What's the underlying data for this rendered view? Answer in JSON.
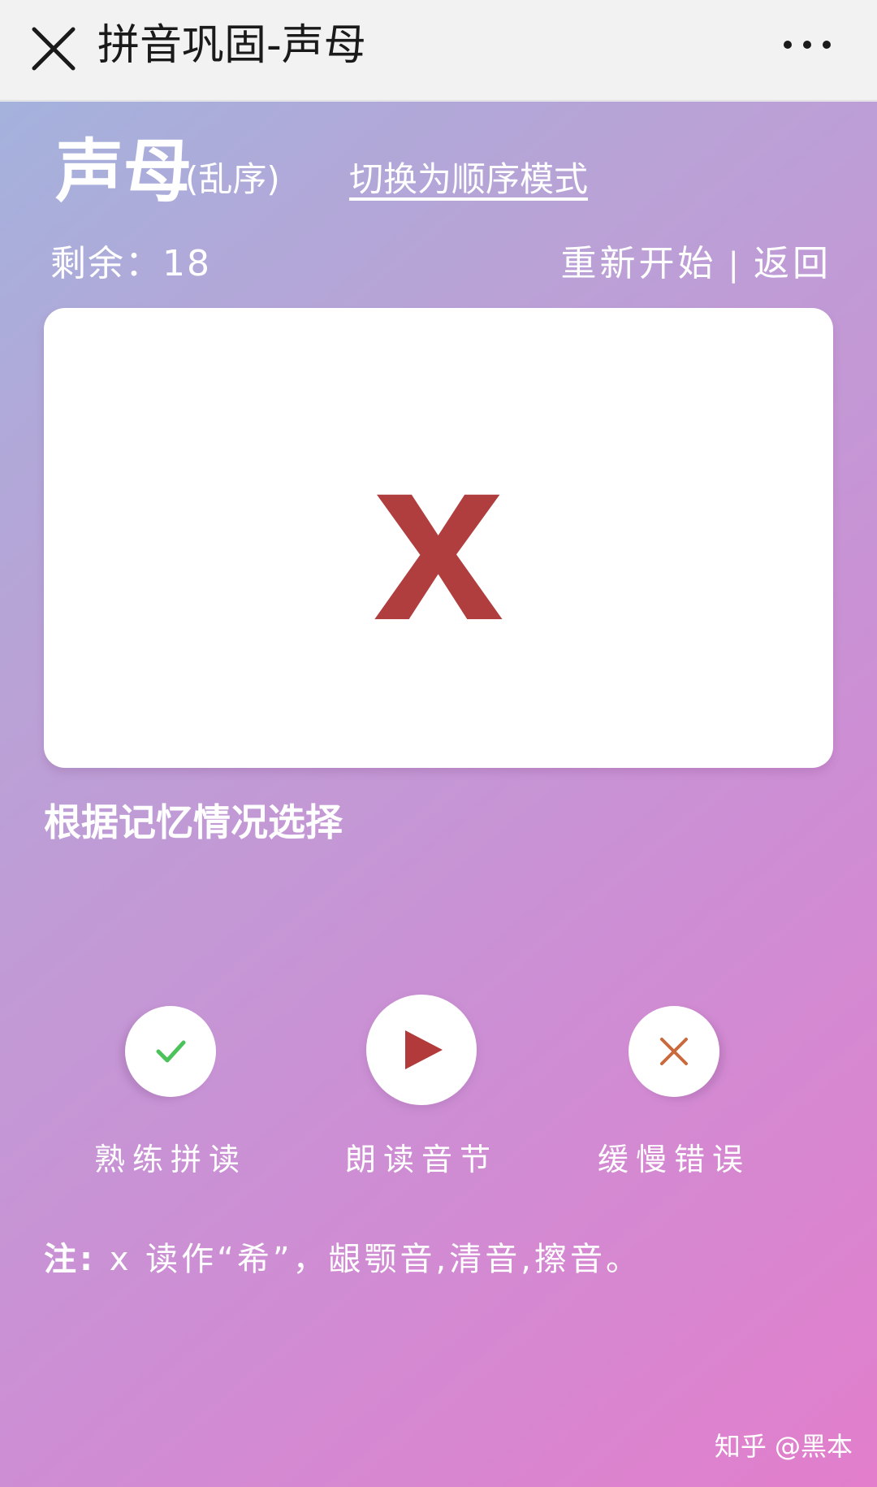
{
  "nav": {
    "title": "拼音巩固-声母",
    "close_icon": "close-icon",
    "more_icon": "more-dots-icon"
  },
  "heading": {
    "main": "声母",
    "mode": "(乱序)",
    "switch_link": "切换为顺序模式"
  },
  "status": {
    "remaining": "剩余：18",
    "restart": "重新开始",
    "separator": "|",
    "back": "返回"
  },
  "card": {
    "letter": "x"
  },
  "prompt": "根据记忆情况选择",
  "buttons": [
    {
      "label": "熟练拼读",
      "icon": "check-icon"
    },
    {
      "label": "朗读音节",
      "icon": "play-icon"
    },
    {
      "label": "缓慢错误",
      "icon": "cross-icon"
    }
  ],
  "note": {
    "label": "注:",
    "text": " x 读作“希”，龈颚音,清音,擦音。"
  },
  "watermark": "知乎 @黑本",
  "colors": {
    "letter": "#b03e3e",
    "check": "#4cc35a",
    "play": "#b23a3a",
    "cross": "#c9693c",
    "gradient_start": "#a4b2dc",
    "gradient_end": "#e27ecc"
  }
}
